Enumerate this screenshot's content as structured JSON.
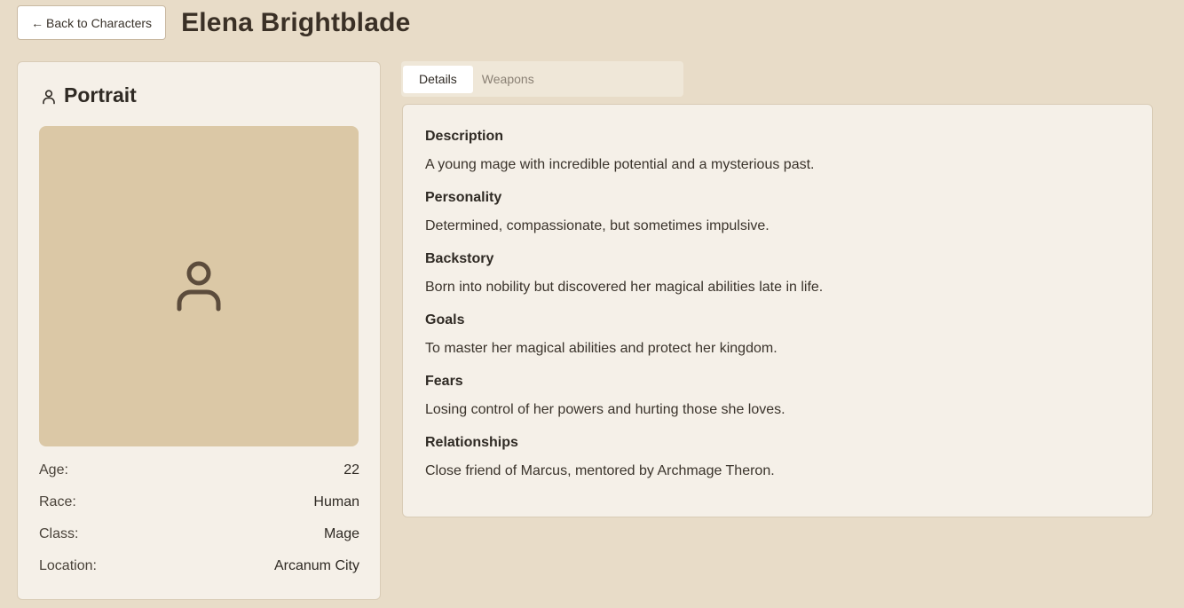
{
  "header": {
    "back_label": "Back to Characters",
    "title": "Elena Brightblade"
  },
  "portrait": {
    "heading": "Portrait",
    "icon": "user-icon",
    "stats": [
      {
        "label": "Age:",
        "value": "22"
      },
      {
        "label": "Race:",
        "value": "Human"
      },
      {
        "label": "Class:",
        "value": "Mage"
      },
      {
        "label": "Location:",
        "value": "Arcanum City"
      }
    ]
  },
  "tabs": [
    {
      "label": "Details",
      "active": true
    },
    {
      "label": "Weapons",
      "active": false
    }
  ],
  "details": [
    {
      "heading": "Description",
      "text": "A young mage with incredible potential and a mysterious past."
    },
    {
      "heading": "Personality",
      "text": "Determined, compassionate, but sometimes impulsive."
    },
    {
      "heading": "Backstory",
      "text": "Born into nobility but discovered her magical abilities late in life."
    },
    {
      "heading": "Goals",
      "text": "To master her magical abilities and protect her kingdom."
    },
    {
      "heading": "Fears",
      "text": "Losing control of her powers and hurting those she loves."
    },
    {
      "heading": "Relationships",
      "text": "Close friend of Marcus, mentored by Archmage Theron."
    }
  ],
  "colors": {
    "background": "#e8dcc8",
    "card": "#f5f0e8",
    "portrait_placeholder": "#dbc8a6",
    "text": "#2f2a24"
  }
}
